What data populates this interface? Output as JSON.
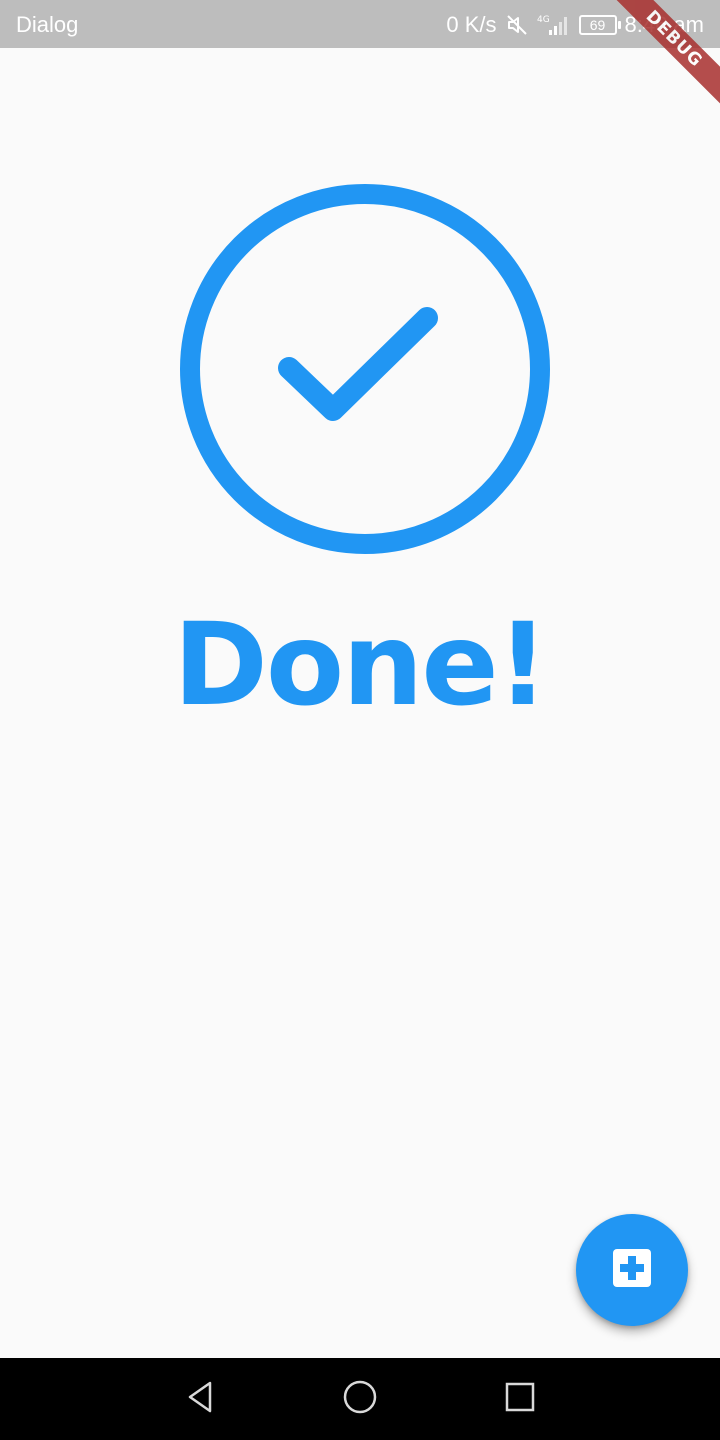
{
  "status_bar": {
    "title": "Dialog",
    "network_speed": "0 K/s",
    "network_type": "4G",
    "battery_level": "69",
    "time": "8:46 am",
    "icons": [
      "mute-icon",
      "signal-icon",
      "battery-icon"
    ]
  },
  "debug_banner": {
    "label": "DEBUG"
  },
  "main": {
    "status_icon": "check-circle-icon",
    "title": "Done!"
  },
  "fab": {
    "icon": "medical-plus-icon"
  },
  "nav_bar": {
    "buttons": [
      "back-icon",
      "home-icon",
      "recents-icon"
    ]
  },
  "colors": {
    "accent": "#2196F3",
    "background": "#FAFAFA",
    "status_bar": "#BDBDBD",
    "debug_banner": "#A8302E",
    "nav_bar": "#000000"
  }
}
